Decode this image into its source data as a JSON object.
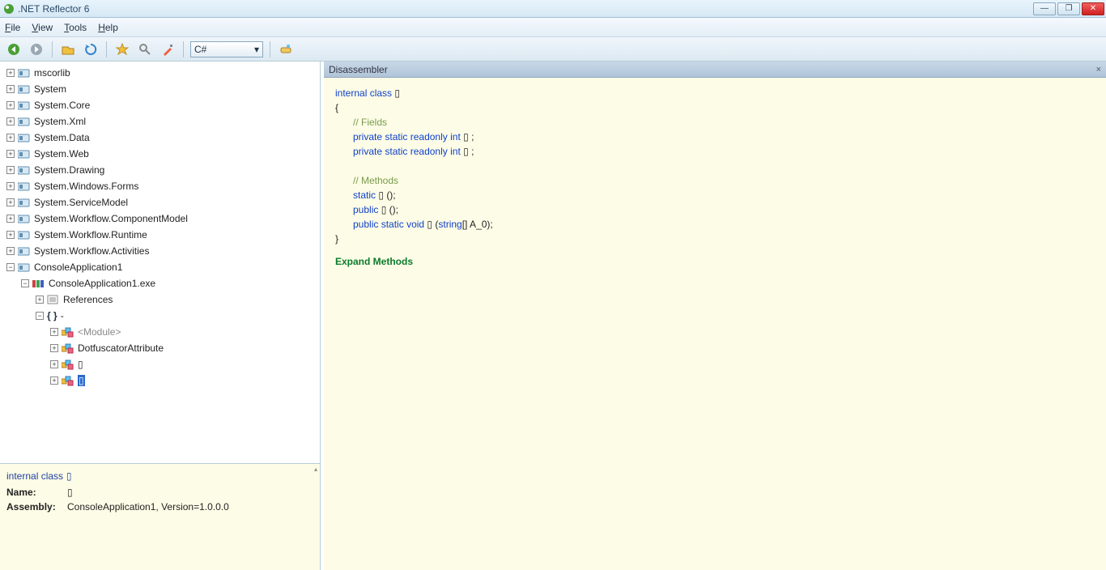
{
  "title": ".NET Reflector 6",
  "menu": {
    "file": "File",
    "view": "View",
    "tools": "Tools",
    "help": "Help"
  },
  "toolbar": {
    "language": "C#"
  },
  "tree": {
    "items": [
      {
        "label": "mscorlib",
        "exp": "+",
        "lvl": 0,
        "icon": "asm"
      },
      {
        "label": "System",
        "exp": "+",
        "lvl": 0,
        "icon": "asm"
      },
      {
        "label": "System.Core",
        "exp": "+",
        "lvl": 0,
        "icon": "asm"
      },
      {
        "label": "System.Xml",
        "exp": "+",
        "lvl": 0,
        "icon": "asm"
      },
      {
        "label": "System.Data",
        "exp": "+",
        "lvl": 0,
        "icon": "asm"
      },
      {
        "label": "System.Web",
        "exp": "+",
        "lvl": 0,
        "icon": "asm"
      },
      {
        "label": "System.Drawing",
        "exp": "+",
        "lvl": 0,
        "icon": "asm"
      },
      {
        "label": "System.Windows.Forms",
        "exp": "+",
        "lvl": 0,
        "icon": "asm"
      },
      {
        "label": "System.ServiceModel",
        "exp": "+",
        "lvl": 0,
        "icon": "asm"
      },
      {
        "label": "System.Workflow.ComponentModel",
        "exp": "+",
        "lvl": 0,
        "icon": "asm"
      },
      {
        "label": "System.Workflow.Runtime",
        "exp": "+",
        "lvl": 0,
        "icon": "asm"
      },
      {
        "label": "System.Workflow.Activities",
        "exp": "+",
        "lvl": 0,
        "icon": "asm"
      },
      {
        "label": "ConsoleApplication1",
        "exp": "−",
        "lvl": 0,
        "icon": "asm"
      },
      {
        "label": "ConsoleApplication1.exe",
        "exp": "−",
        "lvl": 1,
        "icon": "mod"
      },
      {
        "label": "References",
        "exp": "+",
        "lvl": 2,
        "icon": "ref"
      },
      {
        "label": "-",
        "prefix": "{ }",
        "exp": "−",
        "lvl": 2,
        "icon": "ns"
      },
      {
        "label": "<Module>",
        "exp": "+",
        "lvl": 3,
        "icon": "class",
        "grey": true
      },
      {
        "label": "DotfuscatorAttribute",
        "exp": "+",
        "lvl": 3,
        "icon": "class"
      },
      {
        "label": "▯",
        "exp": "+",
        "lvl": 3,
        "icon": "class-obf"
      },
      {
        "label": "▯",
        "exp": "+",
        "lvl": 3,
        "icon": "class-obf",
        "selected": true
      }
    ]
  },
  "details": {
    "heading_prefix": "internal class",
    "heading_symbol": "▯",
    "name_label": "Name:",
    "name_value": "▯",
    "assembly_label": "Assembly:",
    "assembly_value": "ConsoleApplication1, Version=1.0.0.0"
  },
  "disassembler": {
    "title": "Disassembler",
    "close": "×",
    "code": {
      "line1_kw1": "internal",
      "line1_kw2": "class",
      "line1_sym": "▯",
      "brace_open": "{",
      "brace_close": "}",
      "fields_comment": "// Fields",
      "field_kw1": "private",
      "field_kw2": "static",
      "field_kw3": "readonly",
      "field_ty": "int",
      "field_sym": "▯",
      "semi": ";",
      "methods_comment": "// Methods",
      "m1_kw1": "static",
      "m1_sym": "▯",
      "m1_paren": "();",
      "m2_kw1": "public",
      "m2_sym": "▯",
      "m2_paren": "();",
      "m3_kw1": "public",
      "m3_kw2": "static",
      "m3_kw3": "void",
      "m3_sym": "▯",
      "m3_sig_open": " (",
      "m3_sig_ty": "string",
      "m3_sig_rest": "[] A_0);",
      "expand": "Expand Methods"
    }
  }
}
